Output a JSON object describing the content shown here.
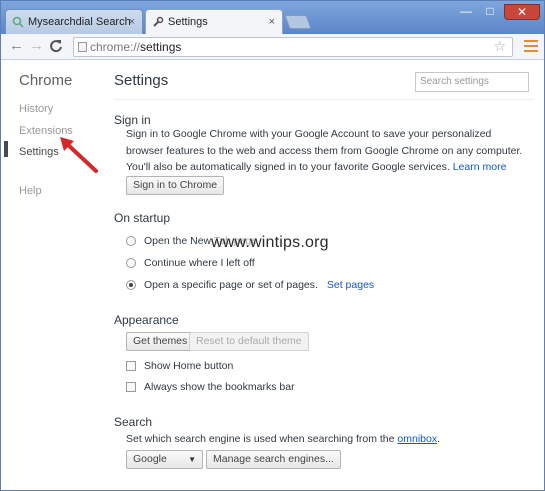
{
  "window": {
    "tabs": [
      {
        "label": "Mysearchdial Search",
        "close": "×",
        "active": false
      },
      {
        "label": "Settings",
        "close": "×",
        "active": true
      }
    ],
    "controls": {
      "minimize": "—",
      "maximize": "□",
      "close": "✕"
    }
  },
  "toolbar": {
    "back": "←",
    "forward": "→",
    "reload": "C",
    "url_scheme": "chrome://",
    "url_path": "settings",
    "star": "☆"
  },
  "sidebar": {
    "title": "Chrome",
    "items": [
      {
        "label": "History",
        "selected": false
      },
      {
        "label": "Extensions",
        "selected": false
      },
      {
        "label": "Settings",
        "selected": true
      },
      {
        "label": "Help",
        "selected": false
      }
    ]
  },
  "main": {
    "title": "Settings",
    "search_placeholder": "Search settings",
    "sign_in": {
      "heading": "Sign in",
      "text": "Sign in to Google Chrome with your Google Account to save your personalized browser features to the web and access them from Google Chrome on any computer. You'll also be automatically signed in to your favorite Google services.",
      "learn_more": "Learn more",
      "button": "Sign in to Chrome"
    },
    "on_startup": {
      "heading": "On startup",
      "options": [
        {
          "label": "Open the New Tab page",
          "checked": false
        },
        {
          "label": "Continue where I left off",
          "checked": false
        },
        {
          "label": "Open a specific page or set of pages.",
          "checked": true
        }
      ],
      "set_pages": "Set pages"
    },
    "appearance": {
      "heading": "Appearance",
      "get_themes": "Get themes",
      "reset_theme": "Reset to default theme",
      "show_home": "Show Home button",
      "show_bookmarks": "Always show the bookmarks bar"
    },
    "search": {
      "heading": "Search",
      "text": "Set which search engine is used when searching from the",
      "omnibox_link": "omnibox",
      "text_end": ".",
      "engine": "Google",
      "manage": "Manage search engines..."
    }
  },
  "watermark": "www.wintips.org",
  "colors": {
    "accent_arrow": "#d4282b",
    "link": "#1155cc",
    "titlebar": "#6a93d0"
  }
}
